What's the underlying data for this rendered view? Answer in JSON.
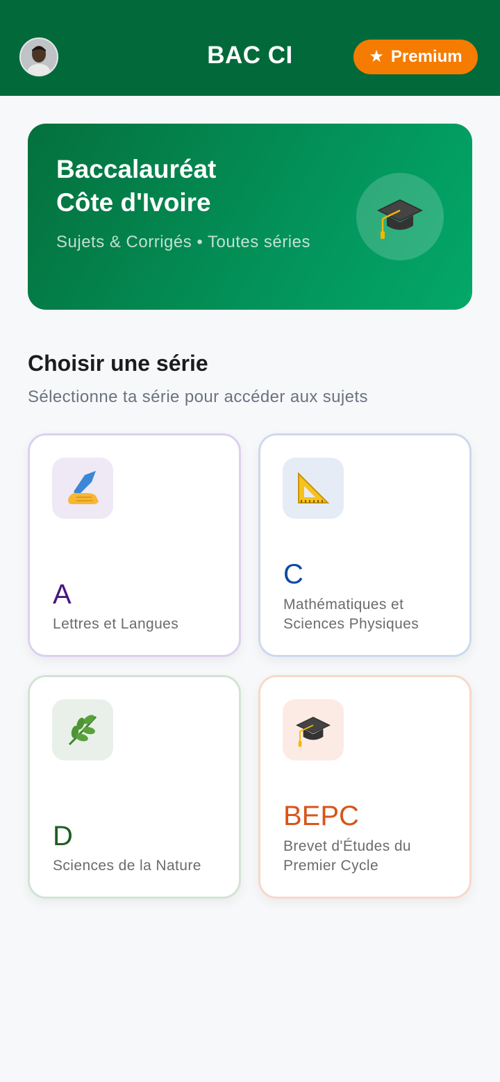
{
  "header": {
    "title": "BAC CI",
    "premium_label": "Premium",
    "premium_icon": "star-icon",
    "avatar_icon": "user-avatar"
  },
  "hero": {
    "title_line1": "Baccalauréat",
    "title_line2": "Côte d'Ivoire",
    "subtitle": "Sujets & Corrigés • Toutes séries",
    "icon": "graduation-cap-icon"
  },
  "section": {
    "title": "Choisir une série",
    "subtitle": "Sélectionne ta série pour accéder aux sujets"
  },
  "series": [
    {
      "code": "A",
      "description": "Lettres et Langues",
      "icon": "writing-hand-icon",
      "color": "#4a1580"
    },
    {
      "code": "C",
      "description": "Mathématiques et Sciences Physiques",
      "icon": "triangular-ruler-icon",
      "color": "#0f4aa0"
    },
    {
      "code": "D",
      "description": "Sciences de la Nature",
      "icon": "herb-icon",
      "color": "#1e5e22"
    },
    {
      "code": "BEPC",
      "description": "Brevet d'Études du Premier Cycle",
      "icon": "graduation-cap-icon",
      "color": "#d9541a"
    }
  ],
  "colors": {
    "header_bg": "#026a3a",
    "premium_bg": "#f57c00",
    "hero_gradient_start": "#04703d",
    "hero_gradient_end": "#03a868"
  }
}
